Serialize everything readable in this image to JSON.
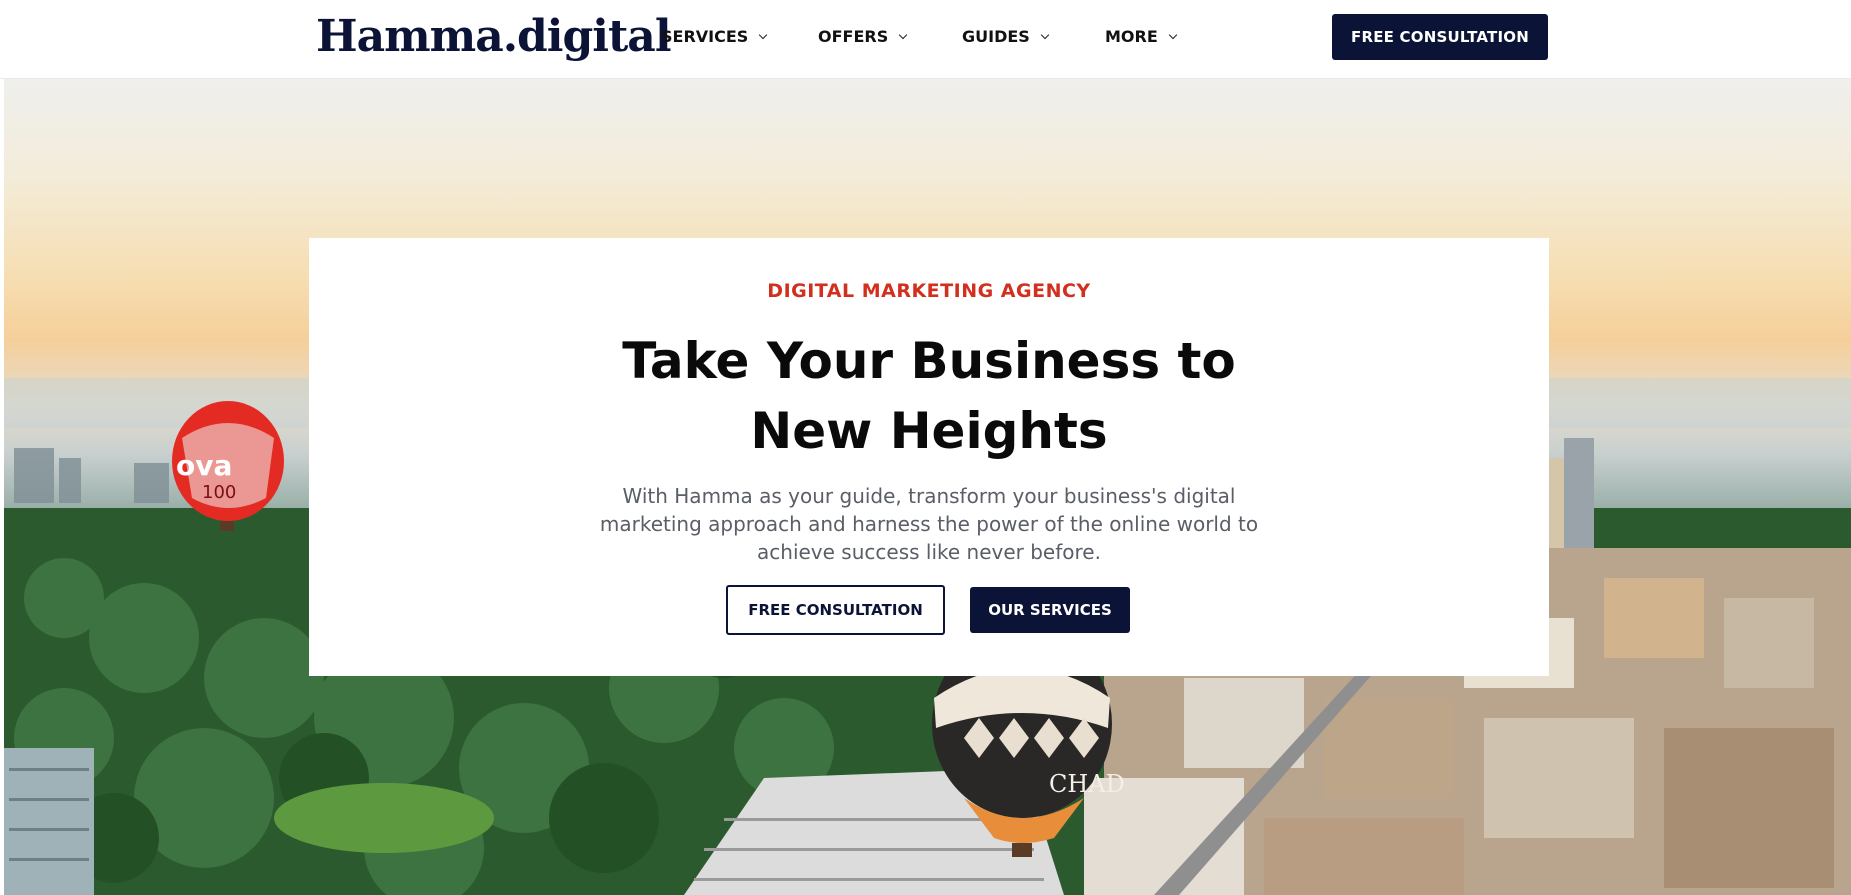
{
  "header": {
    "logo": "Hamma.digital",
    "nav": [
      {
        "label": "SERVICES"
      },
      {
        "label": "OFFERS"
      },
      {
        "label": "GUIDES"
      },
      {
        "label": "MORE"
      }
    ],
    "cta_label": "FREE CONSULTATION"
  },
  "hero": {
    "eyebrow": "DIGITAL MARKETING AGENCY",
    "headline": "Take Your Business to New Heights",
    "subtext": "With Hamma as your guide, transform your business's digital marketing approach and harness the power of the online world to achieve success like never before.",
    "primary_button": "FREE CONSULTATION",
    "secondary_button": "OUR SERVICES",
    "balloon_left_text": "nova 100",
    "balloon_center_text": "CHADS"
  },
  "colors": {
    "brand_navy": "#0b1336",
    "accent_red": "#d32f1e",
    "body_text": "#5a5e66"
  }
}
